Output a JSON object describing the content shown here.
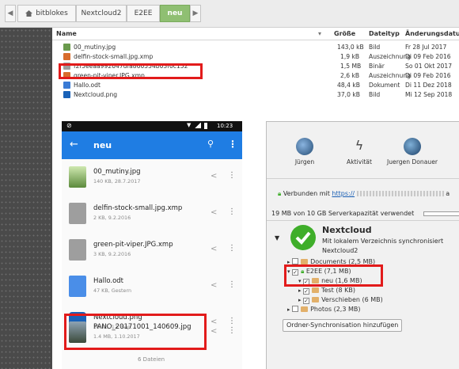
{
  "breadcrumb": {
    "items": [
      {
        "label": "bitblokes"
      },
      {
        "label": "Nextcloud2"
      },
      {
        "label": "E2EE"
      },
      {
        "label": "neu"
      }
    ]
  },
  "file_list": {
    "columns": [
      "Name",
      "Größe",
      "Dateityp",
      "Änderungsdatum"
    ],
    "rows": [
      {
        "name": "00_mutiny.jpg",
        "size": "143,0 kB",
        "type": "Bild",
        "date": "Fr 28 Jul 2017"
      },
      {
        "name": "delfin-stock-small.jpg.xmp",
        "size": "1,9 kB",
        "type": "Auszeichnung",
        "date": "Di 09 Feb 2016"
      },
      {
        "name": "f2f5eeaa992647dfa860554b03f0c152",
        "size": "1,5 MB",
        "type": "Binär",
        "date": "So 01 Okt 2017"
      },
      {
        "name": "green-pit-viper.JPG.xmp",
        "size": "2,6 kB",
        "type": "Auszeichnung",
        "date": "Di 09 Feb 2016"
      },
      {
        "name": "Hallo.odt",
        "size": "48,4 kB",
        "type": "Dokument",
        "date": "Di 11 Dez 2018"
      },
      {
        "name": "Nextcloud.png",
        "size": "37,0 kB",
        "type": "Bild",
        "date": "Mi 12 Sep 2018"
      }
    ]
  },
  "android": {
    "status_time": "10:23",
    "title": "neu",
    "items": [
      {
        "title": "00_mutiny.jpg",
        "sub": "140 KB, 28.7.2017"
      },
      {
        "title": "delfin-stock-small.jpg.xmp",
        "sub": "2 KB, 9.2.2016"
      },
      {
        "title": "green-pit-viper.JPG.xmp",
        "sub": "3 KB, 9.2.2016"
      },
      {
        "title": "Hallo.odt",
        "sub": "47 KB, Gestern"
      },
      {
        "title": "Nextcloud.png",
        "sub": "36 KB, 12. Sep."
      },
      {
        "title": "PANO_20171001_140609.jpg",
        "sub": "1.4 MB, 1.10.2017"
      }
    ],
    "footer": "6 Dateien"
  },
  "nc_client": {
    "tabs": [
      {
        "label": "Jürgen"
      },
      {
        "label": "Aktivität"
      },
      {
        "label": "Juergen Donauer"
      }
    ],
    "connected_prefix": "Verbunden mit",
    "connected_link": "https://",
    "connected_suffix": "a",
    "usage": "19 MB von 10 GB Serverkapazität verwendet",
    "account_title": "Nextcloud",
    "account_desc": "Mit lokalem Verzeichnis synchronisiert",
    "account_folder": "Nextcloud2",
    "tree": [
      {
        "label": "Documents (2,5 MB)"
      },
      {
        "label": "E2EE (7,1 MB)"
      },
      {
        "label": "neu (1,6 MB)"
      },
      {
        "label": "Test (8 KB)"
      },
      {
        "label": "Verschieben (6 MB)"
      },
      {
        "label": "Photos (2,3 MB)"
      }
    ],
    "add_button": "Ordner-Synchronisation hinzufügen"
  },
  "colors": {
    "accent_green": "#8fbf72",
    "android_blue": "#1f7de3",
    "highlight_red": "#e21b1b",
    "nc_green": "#3fae2a"
  }
}
